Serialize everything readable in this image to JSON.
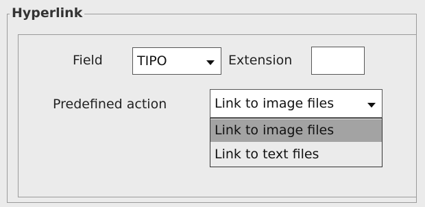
{
  "group": {
    "title": "Hyperlink"
  },
  "field": {
    "label": "Field",
    "selected": "TIPO"
  },
  "extension": {
    "label": "Extension",
    "value": ""
  },
  "predefined_action": {
    "label": "Predefined action",
    "selected": "Link to image files",
    "options": [
      "Link to image files",
      "Link to text files"
    ],
    "highlighted_index": 0
  }
}
